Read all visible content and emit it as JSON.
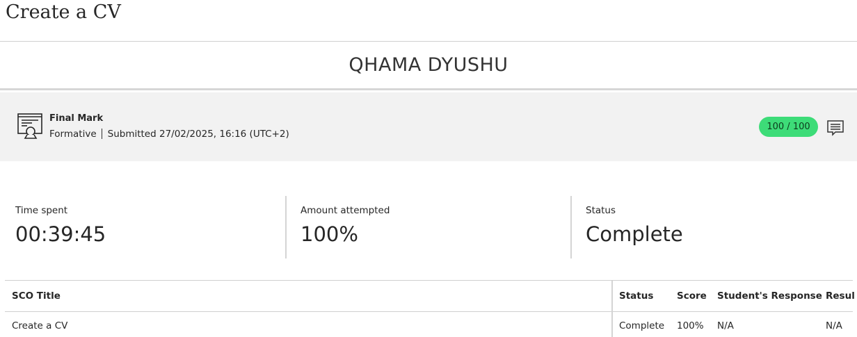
{
  "page": {
    "title": "Create a CV"
  },
  "student": {
    "name": "QHAMA DYUSHU"
  },
  "grade": {
    "title": "Final Mark",
    "category": "Formative",
    "submitted": "Submitted 27/02/2025, 16:16 (UTC+2)",
    "score": "100 / 100",
    "score_color": "#3ddc78",
    "icon": "certificate-icon",
    "feedback_icon": "feedback-icon"
  },
  "stats": {
    "time_spent": {
      "label": "Time spent",
      "value": "00:39:45"
    },
    "amount_attempted": {
      "label": "Amount attempted",
      "value": "100%"
    },
    "status": {
      "label": "Status",
      "value": "Complete"
    }
  },
  "table": {
    "headers": [
      "SCO Title",
      "Status",
      "Score",
      "Student's Response",
      "Resul"
    ],
    "rows": [
      [
        "Create a CV",
        "Complete",
        "100%",
        "N/A",
        "N/A"
      ]
    ]
  }
}
